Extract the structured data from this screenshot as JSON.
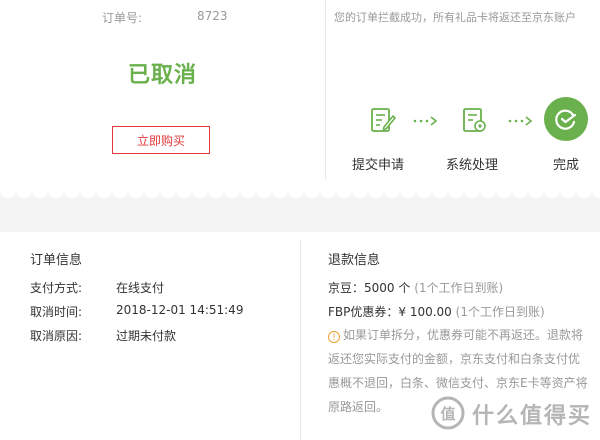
{
  "order": {
    "number_label": "订单号:",
    "number_value": "8723",
    "status": "已取消",
    "buy_button": "立即购买"
  },
  "progress": {
    "notice": "您的订单拦截成功，所有礼品卡将返还至京东账户",
    "steps": [
      {
        "label": "提交申请",
        "icon": "form-edit-icon"
      },
      {
        "label": "系统处理",
        "icon": "document-gear-icon"
      },
      {
        "label": "完成",
        "icon": "checkmark-circle-icon"
      }
    ],
    "accent_color": "#6ab04c"
  },
  "order_info": {
    "title": "订单信息",
    "rows": [
      {
        "label": "支付方式:",
        "value": "在线支付"
      },
      {
        "label": "取消时间:",
        "value": "2018-12-01 14:51:49"
      },
      {
        "label": "取消原因:",
        "value": "过期未付款"
      }
    ]
  },
  "refund_info": {
    "title": "退款信息",
    "lines": [
      {
        "text": "京豆：5000 个",
        "hint": "(1个工作日到账)"
      },
      {
        "text": "FBP优惠券：¥ 100.00",
        "hint": "(1个工作日到账)"
      }
    ],
    "warning": "如果订单拆分，优惠券可能不再返还。退款将返还您实际支付的金额，京东支付和白条支付优惠概不退回，白条、微信支付、京东E卡等资产将原路返回。"
  },
  "watermark": {
    "text": "什么值得买",
    "logo_char": "值"
  }
}
